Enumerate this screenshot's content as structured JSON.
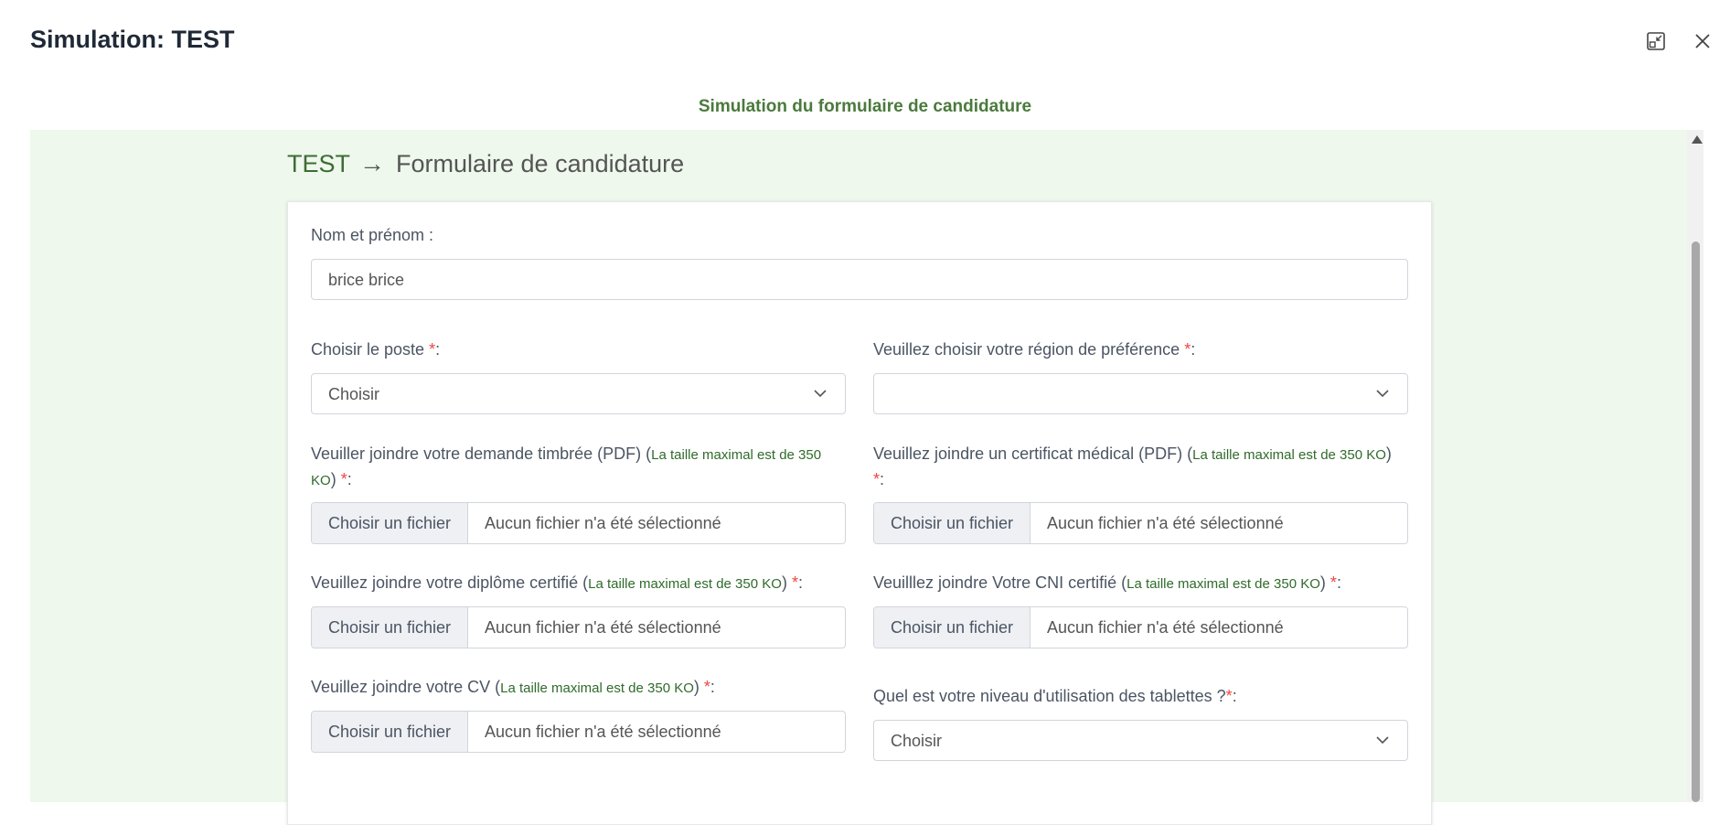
{
  "modal": {
    "title": "Simulation: TEST",
    "subtitle": "Simulation du formulaire de candidature"
  },
  "breadcrumb": {
    "test": "TEST",
    "arrow": "→",
    "form": "Formulaire de candidature"
  },
  "form": {
    "name_label": "Nom et prénom :",
    "name_value": "brice brice",
    "poste_label": "Choisir le poste ",
    "poste_value": "Choisir",
    "region_label": "Veuillez choisir votre région de préférence ",
    "region_value": "",
    "demande_label": "Veuiller joindre votre demande timbrée (PDF) (",
    "demande_hint1": "La taille maximal est de 350",
    "demande_hint2": "KO",
    "certif_label": "Veuillez joindre un certificat médical (PDF) (",
    "diplome_label": "Veuillez joindre votre diplôme certifié (",
    "cni_label": "Veuilllez joindre Votre CNI certifié (",
    "cv_label": "Veuillez joindre votre CV (",
    "tablette_label": "Quel est votre niveau d'utilisation des tablettes ?",
    "tablette_value": "Choisir",
    "hint": "La taille maximal est de 350 KO",
    "close_paren": ")",
    "req": "*",
    "colon": ":",
    "file_button": "Choisir un fichier",
    "file_placeholder": "Aucun fichier n'a été sélectionné"
  },
  "colors": {
    "accent_green": "#4a7a3c",
    "content_bg": "#eef8ec",
    "required": "#ef4444"
  },
  "icons": [
    "minimize-icon",
    "close-icon",
    "chevron-down-icon",
    "scroll-up-arrow-icon"
  ]
}
